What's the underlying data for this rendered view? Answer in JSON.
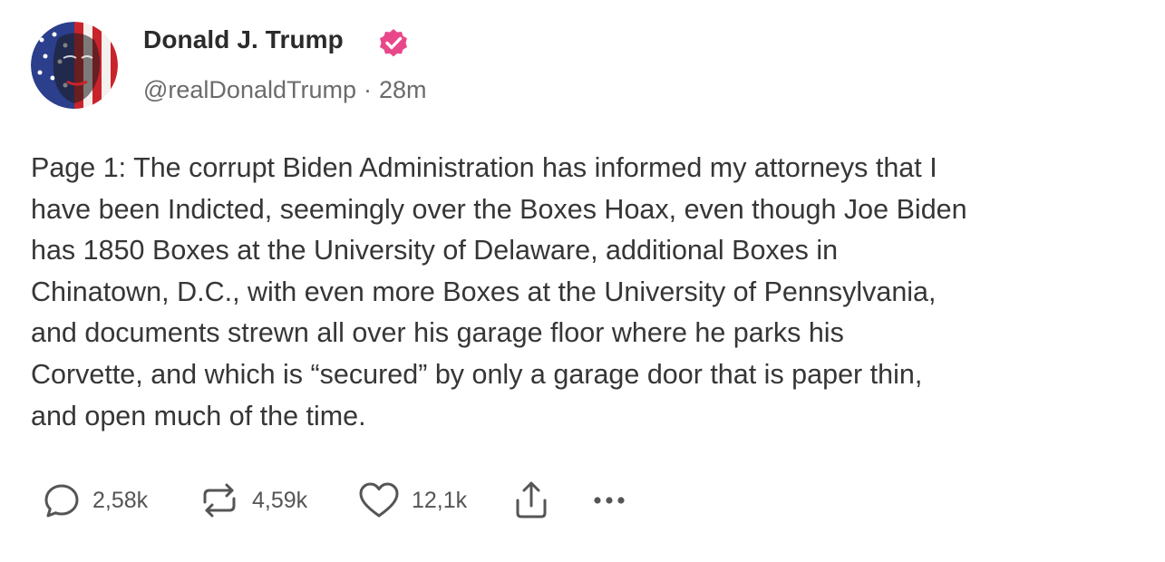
{
  "author": {
    "name": "Donald J. Trump",
    "handle": "@realDonaldTrump",
    "separator": "·",
    "time": "28m",
    "verified_icon": "verified-badge-icon",
    "verified_color": "#e8488a"
  },
  "post": {
    "lines": [
      "Page 1: The corrupt Biden Administration has informed my attorneys that I",
      "have been Indicted, seemingly over the Boxes Hoax, even though Joe Biden",
      "has 1850 Boxes at the University of Delaware, additional Boxes in",
      "Chinatown, D.C., with even more Boxes at the University of Pennsylvania,",
      "and documents strewn all over his garage floor where he parks his",
      "Corvette, and which is “secured” by only a garage door that is paper thin,",
      "and open much of the time."
    ]
  },
  "actions": {
    "reply": {
      "icon": "reply-icon",
      "count": "2,58k"
    },
    "repost": {
      "icon": "repost-icon",
      "count": "4,59k"
    },
    "like": {
      "icon": "heart-icon",
      "count": "12,1k"
    },
    "share": {
      "icon": "share-icon"
    },
    "more": {
      "icon": "more-icon"
    }
  },
  "colors": {
    "text": "#363636",
    "muted": "#6b6b6b",
    "icon": "#555555"
  }
}
